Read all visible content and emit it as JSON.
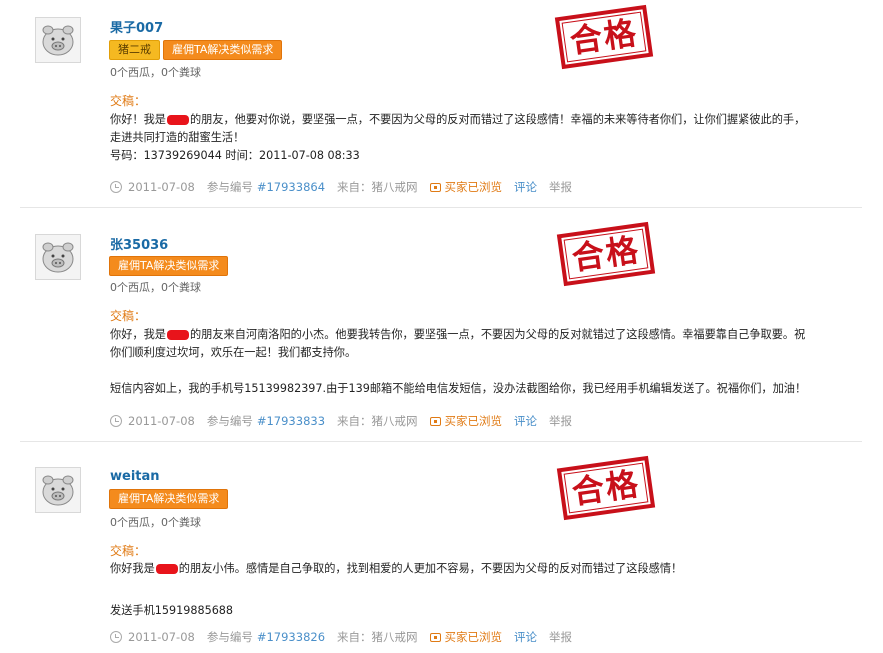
{
  "entries": [
    {
      "username": "果子007",
      "badges": [
        "猪二戒",
        "雇佣TA解决类似需求"
      ],
      "stats": "0个西瓜，0个粪球",
      "label": "交稿：",
      "lines": [
        {
          "before": "你好！我是",
          "after": "的朋友，他要对你说，要坚强一点，不要因为父母的反对而错过了这段感情！幸福的未来等待者你们，让你们握紧彼此的手，"
        },
        {
          "before": "走进共同打造的甜蜜生活！",
          "after": ""
        },
        {
          "before": "号码：13739269044 时间：2011-07-08 08:33",
          "after": ""
        }
      ],
      "date": "2011-07-08",
      "id_label": "参与编号",
      "id": "#17933864",
      "source": "来自：猪八戒网",
      "browsed": "买家已浏览",
      "comment": "评论",
      "report": "举报",
      "stamp": "合格"
    },
    {
      "username": "张35036",
      "badges": [
        "雇佣TA解决类似需求"
      ],
      "stats": "0个西瓜，0个粪球",
      "label": "交稿：",
      "lines": [
        {
          "before": "你好，我是",
          "after": "的朋友来自河南洛阳的小杰。他要我转告你，要坚强一点，不要因为父母的反对就错过了这段感情。幸福要靠自己争取要。祝"
        },
        {
          "before": "你们顺利度过坎坷，欢乐在一起！我们都支持你。",
          "after": ""
        },
        {
          "before": "",
          "after": ""
        },
        {
          "before": "短信内容如上，我的手机号15139982397.由于139邮箱不能给电信发短信，没办法截图给你，我已经用手机编辑发送了。祝福你们，加油！",
          "after": ""
        }
      ],
      "date": "2011-07-08",
      "id_label": "参与编号",
      "id": "#17933833",
      "source": "来自：猪八戒网",
      "browsed": "买家已浏览",
      "comment": "评论",
      "report": "举报",
      "stamp": "合格"
    },
    {
      "username": "weitan",
      "badges": [
        "雇佣TA解决类似需求"
      ],
      "stats": "0个西瓜，0个粪球",
      "label": "交稿：",
      "lines": [
        {
          "before": "你好我是",
          "after": "的朋友小伟。感情是自己争取的，找到相爱的人更加不容易，不要因为父母的反对而错过了这段感情！"
        },
        {
          "before": "",
          "after": ""
        },
        {
          "before": "发送手机15919885688",
          "after": ""
        }
      ],
      "date": "2011-07-08",
      "id_label": "参与编号",
      "id": "#17933826",
      "source": "来自：猪八戒网",
      "browsed": "买家已浏览",
      "comment": "评论",
      "report": "举报",
      "stamp": "合格"
    }
  ],
  "colors": {
    "username": "#1a6aa5",
    "badge_yellow": "#f5b921",
    "badge_orange": "#f48b1d",
    "label": "#e07a14",
    "link": "#4a8fc9",
    "stamp": "#c8101a",
    "redaction": "#e8141b"
  },
  "icons": [
    "pig-avatar-icon",
    "clock-icon",
    "eye-icon"
  ]
}
